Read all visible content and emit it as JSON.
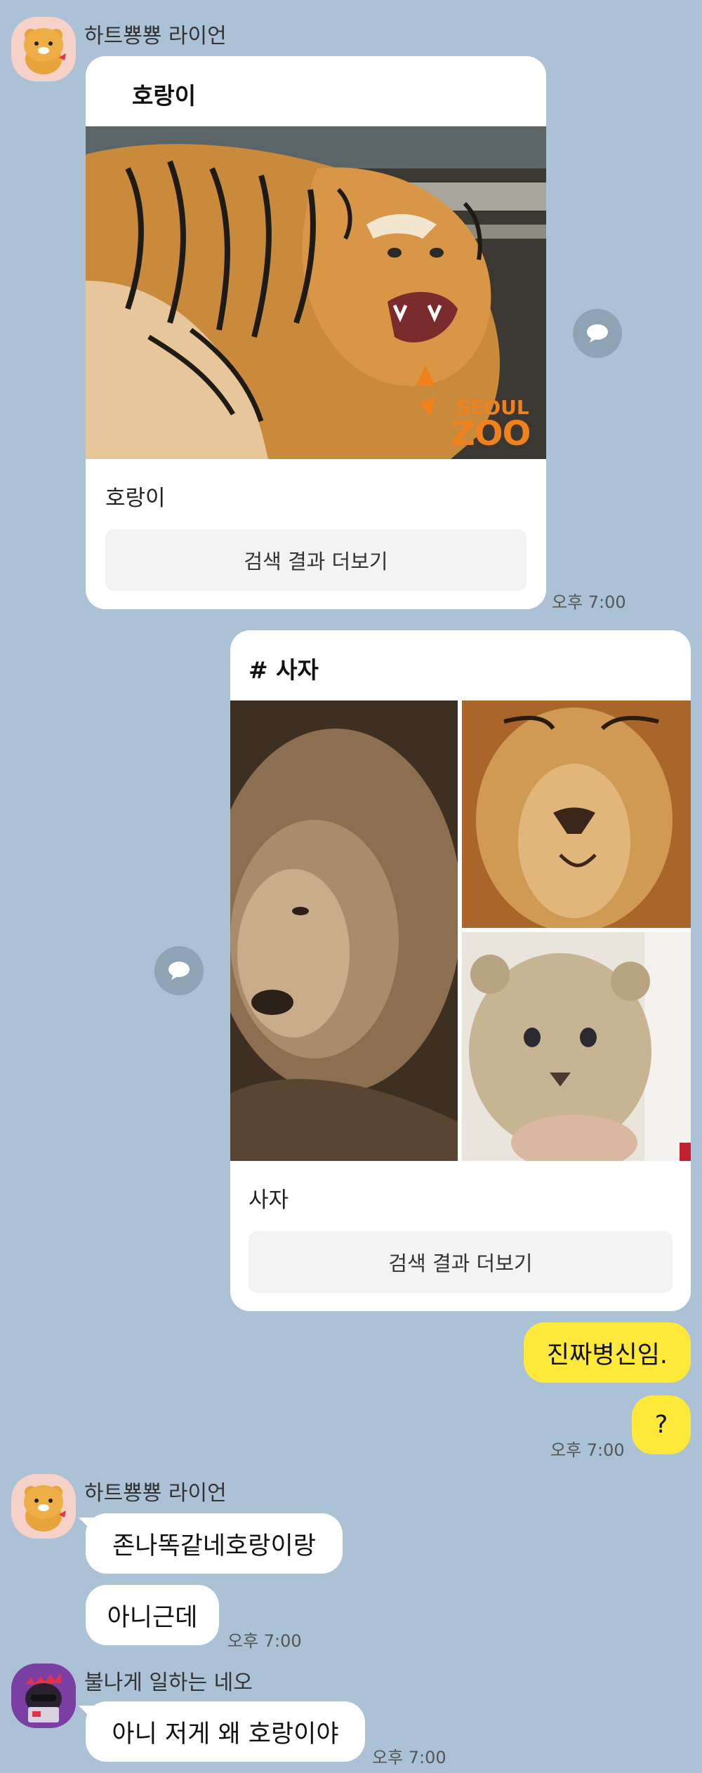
{
  "messages": {
    "m1": {
      "sender": "하트뿅뿅 라이언",
      "card_title": "호랑이",
      "caption": "호랑이",
      "button": "검색 결과 더보기",
      "time": "오후 7:00",
      "image_logo_line1": "SEOUL",
      "image_logo_line2": "ZOO"
    },
    "m2": {
      "card_title": "# 사자",
      "caption": "사자",
      "button": "검색 결과 더보기"
    },
    "m3": {
      "text": "진짜병신임."
    },
    "m4": {
      "text": "?",
      "time": "오후 7:00"
    },
    "m5": {
      "sender": "하트뿅뿅 라이언",
      "text1": "존나똑같네호랑이랑",
      "text2": "아니근데",
      "time": "오후 7:00"
    },
    "m6": {
      "sender": "불나게 일하는 네오",
      "text": "아니 저게 왜 호랑이야",
      "time": "오후 7:00"
    }
  },
  "colors": {
    "background": "#abc2d6",
    "my_bubble": "#fee93a",
    "other_bubble": "#ffffff"
  }
}
